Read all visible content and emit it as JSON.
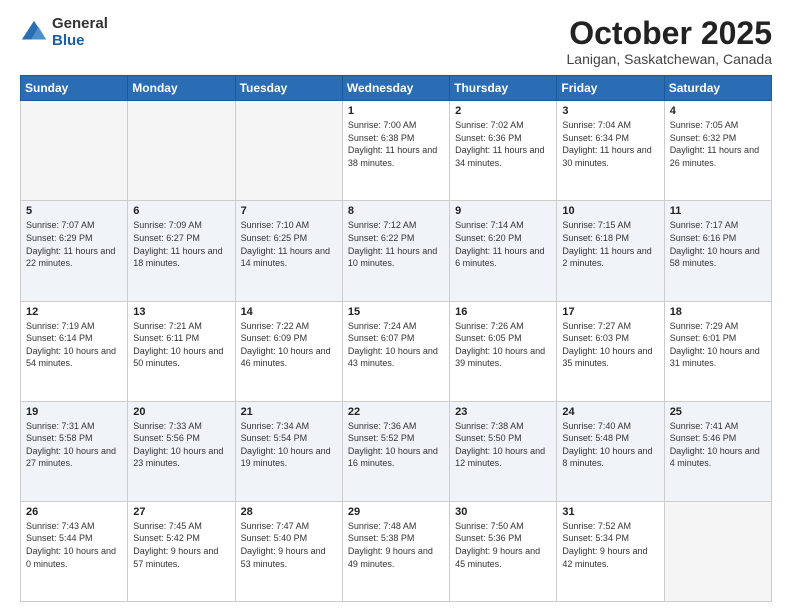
{
  "logo": {
    "general": "General",
    "blue": "Blue"
  },
  "title": "October 2025",
  "subtitle": "Lanigan, Saskatchewan, Canada",
  "weekdays": [
    "Sunday",
    "Monday",
    "Tuesday",
    "Wednesday",
    "Thursday",
    "Friday",
    "Saturday"
  ],
  "weeks": [
    [
      {
        "day": "",
        "empty": true
      },
      {
        "day": "",
        "empty": true
      },
      {
        "day": "",
        "empty": true
      },
      {
        "day": "1",
        "sunrise": "Sunrise: 7:00 AM",
        "sunset": "Sunset: 6:38 PM",
        "daylight": "Daylight: 11 hours and 38 minutes."
      },
      {
        "day": "2",
        "sunrise": "Sunrise: 7:02 AM",
        "sunset": "Sunset: 6:36 PM",
        "daylight": "Daylight: 11 hours and 34 minutes."
      },
      {
        "day": "3",
        "sunrise": "Sunrise: 7:04 AM",
        "sunset": "Sunset: 6:34 PM",
        "daylight": "Daylight: 11 hours and 30 minutes."
      },
      {
        "day": "4",
        "sunrise": "Sunrise: 7:05 AM",
        "sunset": "Sunset: 6:32 PM",
        "daylight": "Daylight: 11 hours and 26 minutes."
      }
    ],
    [
      {
        "day": "5",
        "sunrise": "Sunrise: 7:07 AM",
        "sunset": "Sunset: 6:29 PM",
        "daylight": "Daylight: 11 hours and 22 minutes."
      },
      {
        "day": "6",
        "sunrise": "Sunrise: 7:09 AM",
        "sunset": "Sunset: 6:27 PM",
        "daylight": "Daylight: 11 hours and 18 minutes."
      },
      {
        "day": "7",
        "sunrise": "Sunrise: 7:10 AM",
        "sunset": "Sunset: 6:25 PM",
        "daylight": "Daylight: 11 hours and 14 minutes."
      },
      {
        "day": "8",
        "sunrise": "Sunrise: 7:12 AM",
        "sunset": "Sunset: 6:22 PM",
        "daylight": "Daylight: 11 hours and 10 minutes."
      },
      {
        "day": "9",
        "sunrise": "Sunrise: 7:14 AM",
        "sunset": "Sunset: 6:20 PM",
        "daylight": "Daylight: 11 hours and 6 minutes."
      },
      {
        "day": "10",
        "sunrise": "Sunrise: 7:15 AM",
        "sunset": "Sunset: 6:18 PM",
        "daylight": "Daylight: 11 hours and 2 minutes."
      },
      {
        "day": "11",
        "sunrise": "Sunrise: 7:17 AM",
        "sunset": "Sunset: 6:16 PM",
        "daylight": "Daylight: 10 hours and 58 minutes."
      }
    ],
    [
      {
        "day": "12",
        "sunrise": "Sunrise: 7:19 AM",
        "sunset": "Sunset: 6:14 PM",
        "daylight": "Daylight: 10 hours and 54 minutes."
      },
      {
        "day": "13",
        "sunrise": "Sunrise: 7:21 AM",
        "sunset": "Sunset: 6:11 PM",
        "daylight": "Daylight: 10 hours and 50 minutes."
      },
      {
        "day": "14",
        "sunrise": "Sunrise: 7:22 AM",
        "sunset": "Sunset: 6:09 PM",
        "daylight": "Daylight: 10 hours and 46 minutes."
      },
      {
        "day": "15",
        "sunrise": "Sunrise: 7:24 AM",
        "sunset": "Sunset: 6:07 PM",
        "daylight": "Daylight: 10 hours and 43 minutes."
      },
      {
        "day": "16",
        "sunrise": "Sunrise: 7:26 AM",
        "sunset": "Sunset: 6:05 PM",
        "daylight": "Daylight: 10 hours and 39 minutes."
      },
      {
        "day": "17",
        "sunrise": "Sunrise: 7:27 AM",
        "sunset": "Sunset: 6:03 PM",
        "daylight": "Daylight: 10 hours and 35 minutes."
      },
      {
        "day": "18",
        "sunrise": "Sunrise: 7:29 AM",
        "sunset": "Sunset: 6:01 PM",
        "daylight": "Daylight: 10 hours and 31 minutes."
      }
    ],
    [
      {
        "day": "19",
        "sunrise": "Sunrise: 7:31 AM",
        "sunset": "Sunset: 5:58 PM",
        "daylight": "Daylight: 10 hours and 27 minutes."
      },
      {
        "day": "20",
        "sunrise": "Sunrise: 7:33 AM",
        "sunset": "Sunset: 5:56 PM",
        "daylight": "Daylight: 10 hours and 23 minutes."
      },
      {
        "day": "21",
        "sunrise": "Sunrise: 7:34 AM",
        "sunset": "Sunset: 5:54 PM",
        "daylight": "Daylight: 10 hours and 19 minutes."
      },
      {
        "day": "22",
        "sunrise": "Sunrise: 7:36 AM",
        "sunset": "Sunset: 5:52 PM",
        "daylight": "Daylight: 10 hours and 16 minutes."
      },
      {
        "day": "23",
        "sunrise": "Sunrise: 7:38 AM",
        "sunset": "Sunset: 5:50 PM",
        "daylight": "Daylight: 10 hours and 12 minutes."
      },
      {
        "day": "24",
        "sunrise": "Sunrise: 7:40 AM",
        "sunset": "Sunset: 5:48 PM",
        "daylight": "Daylight: 10 hours and 8 minutes."
      },
      {
        "day": "25",
        "sunrise": "Sunrise: 7:41 AM",
        "sunset": "Sunset: 5:46 PM",
        "daylight": "Daylight: 10 hours and 4 minutes."
      }
    ],
    [
      {
        "day": "26",
        "sunrise": "Sunrise: 7:43 AM",
        "sunset": "Sunset: 5:44 PM",
        "daylight": "Daylight: 10 hours and 0 minutes."
      },
      {
        "day": "27",
        "sunrise": "Sunrise: 7:45 AM",
        "sunset": "Sunset: 5:42 PM",
        "daylight": "Daylight: 9 hours and 57 minutes."
      },
      {
        "day": "28",
        "sunrise": "Sunrise: 7:47 AM",
        "sunset": "Sunset: 5:40 PM",
        "daylight": "Daylight: 9 hours and 53 minutes."
      },
      {
        "day": "29",
        "sunrise": "Sunrise: 7:48 AM",
        "sunset": "Sunset: 5:38 PM",
        "daylight": "Daylight: 9 hours and 49 minutes."
      },
      {
        "day": "30",
        "sunrise": "Sunrise: 7:50 AM",
        "sunset": "Sunset: 5:36 PM",
        "daylight": "Daylight: 9 hours and 45 minutes."
      },
      {
        "day": "31",
        "sunrise": "Sunrise: 7:52 AM",
        "sunset": "Sunset: 5:34 PM",
        "daylight": "Daylight: 9 hours and 42 minutes."
      },
      {
        "day": "",
        "empty": true
      }
    ]
  ]
}
